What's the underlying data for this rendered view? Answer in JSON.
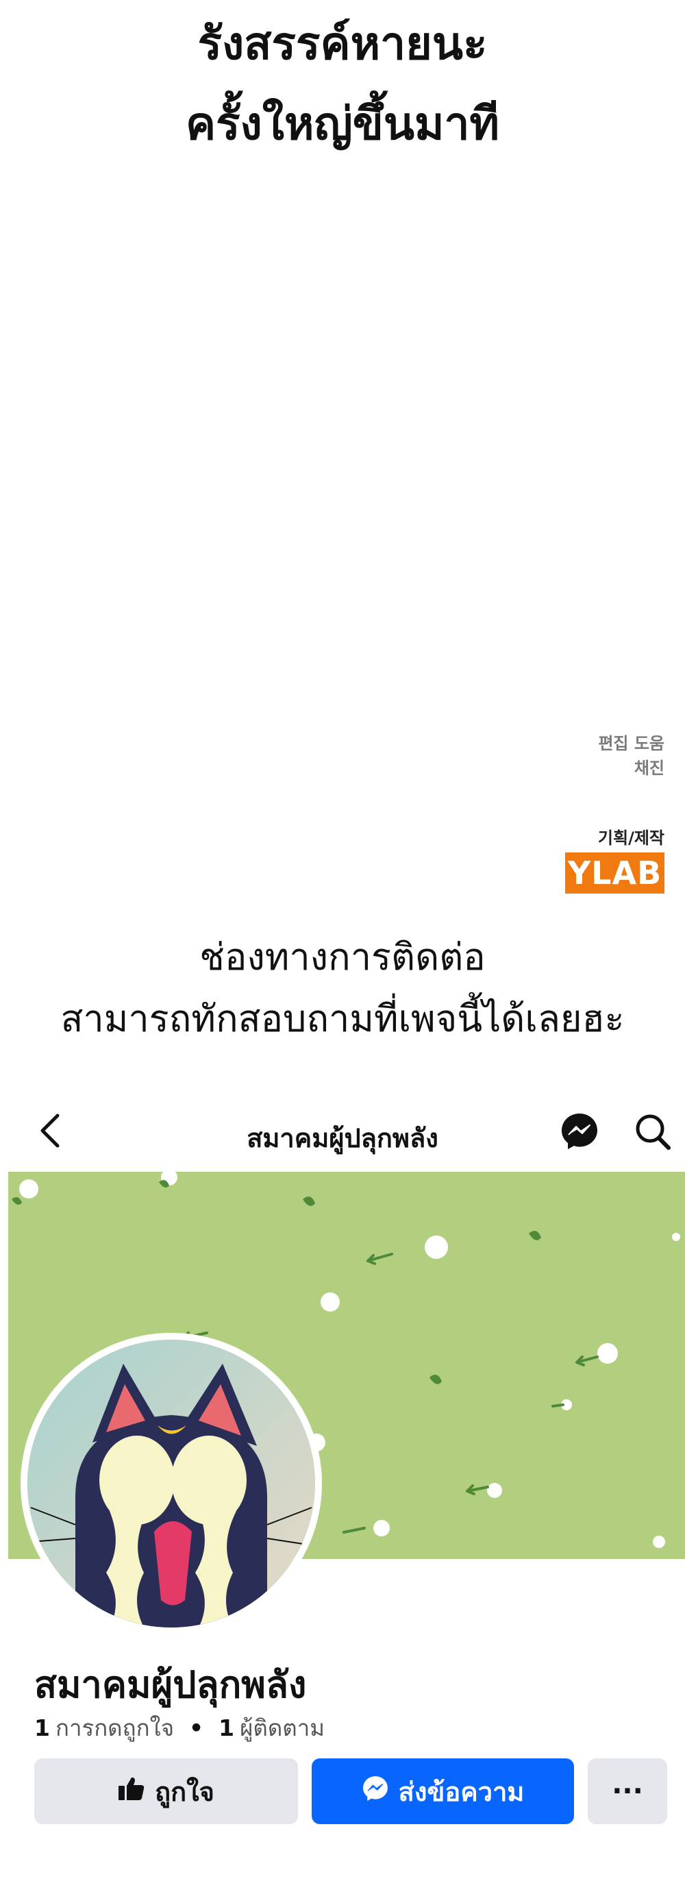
{
  "heading": {
    "line1": "รังสรรค์หายนะ",
    "line2": "ครั้งใหญ่ขึ้นมาที"
  },
  "credits": {
    "editing_label": "편집 도움",
    "editing_name": "채진",
    "production_label": "기획/제작",
    "studio_logo": "YLAB"
  },
  "contact": {
    "line1": "ช่องทางการติดต่อ",
    "line2": "สามารถทักสอบถามที่เพจนี้ได้เลยฮะ"
  },
  "fb_page": {
    "nav_title": "สมาคมผู้ปลุกพลัง",
    "icons": {
      "back": "chevron-left-icon",
      "messenger": "messenger-icon",
      "search": "search-icon"
    },
    "page_name": "สมาคมผู้ปลุกพลัง",
    "likes_count": "1",
    "likes_label": "การกดถูกใจ",
    "separator": "•",
    "followers_count": "1",
    "followers_label": "ผู้ติดตาม",
    "like_button": "ถูกใจ",
    "message_button": "ส่งข้อความ",
    "more_button": "···"
  },
  "colors": {
    "cover_green": "#b2cf7f",
    "messenger_blue": "#0866ff",
    "button_gray": "#e4e6eb",
    "ylab_orange": "#f07a10"
  }
}
